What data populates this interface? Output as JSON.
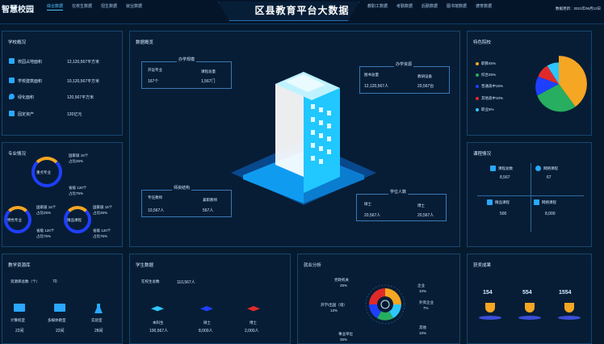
{
  "header": {
    "brand": "智慧校园",
    "nav_left": [
      "综合数据",
      "在校生数据",
      "招生数据",
      "就业数据"
    ],
    "nav_right": [
      "教职工数据",
      "考勤数据",
      "后勤数据",
      "图书馆数据",
      "德育数据"
    ],
    "title": "区县教育平台大数据",
    "time": "数据更新：2021年06月12日"
  },
  "overview": {
    "title": "学校概况",
    "rows": [
      {
        "label": "校园占地面积",
        "value": "12,120,567平方米"
      },
      {
        "label": "学校建筑面积",
        "value": "10,120,567平方米"
      },
      {
        "label": "绿化面积",
        "value": "120,567平方米"
      },
      {
        "label": "固定资产",
        "value": "120亿元"
      }
    ]
  },
  "majors": {
    "title": "专业情况",
    "items": [
      {
        "name": "重点专业",
        "nat": "国家级 15个",
        "nat_pct": "占比25%",
        "prov": "省级 120个",
        "prov_pct": "占比75%"
      },
      {
        "name": "特色专业",
        "nat": "国家级 15个",
        "nat_pct": "占比25%",
        "prov": "省级 120个",
        "prov_pct": "占比75%"
      },
      {
        "name": "精品课程",
        "nat": "国家级 15个",
        "nat_pct": "占比25%",
        "prov": "省级 120个",
        "prov_pct": "占比75%"
      }
    ]
  },
  "center": {
    "title": "数据概览",
    "school": {
      "title": "办学规模",
      "a_label": "开设专业",
      "a_value": "167个",
      "b_label": "课程总量",
      "b_value": "1,567门"
    },
    "resource": {
      "title": "办学资源",
      "a_label": "图书总量",
      "a_value": "12,120,567人",
      "b_label": "教研设备",
      "b_value": "20,567台"
    },
    "staff": {
      "title": "师资结构",
      "a_label": "专任教师",
      "a_value": "10,567人",
      "b_label": "兼职教师",
      "b_value": "567人"
    },
    "degree": {
      "title": "学位人数",
      "a_label": "硕士",
      "a_value": "20,567人",
      "b_label": "博士",
      "b_value": "20,567人"
    }
  },
  "feature": {
    "title": "特色院校",
    "legend": [
      {
        "label": "职教45%",
        "color": "#f5a623"
      },
      {
        "label": "综合25%",
        "color": "#27ae60"
      },
      {
        "label": "普通高中15%",
        "color": "#1f3fff"
      },
      {
        "label": "其他高中10%",
        "color": "#e02a2a"
      },
      {
        "label": "职业5%",
        "color": "#2ec6ff"
      }
    ]
  },
  "courses": {
    "title": "课程情况",
    "items": [
      {
        "label": "课程总数",
        "value": "8,567"
      },
      {
        "label": "网络课程",
        "value": "67"
      },
      {
        "label": "精品课程",
        "value": "500"
      },
      {
        "label": "网络课程",
        "value": "8,000"
      }
    ]
  },
  "teaching": {
    "title": "教学资源库",
    "count_label": "资源库总数（个）",
    "count": "70",
    "items": [
      {
        "label": "计算机室",
        "value": "22间"
      },
      {
        "label": "多媒体教室",
        "value": "22间"
      },
      {
        "label": "实验室",
        "value": "28间"
      }
    ]
  },
  "students": {
    "title": "学生数据",
    "total_label": "在校生总数",
    "total": "110,567人",
    "items": [
      {
        "label": "本科生",
        "value": "100,567人",
        "color": "#2ec6ff"
      },
      {
        "label": "硕士",
        "value": "8,000人",
        "color": "#1f3fff"
      },
      {
        "label": "博士",
        "value": "2,000人",
        "color": "#e02a2a"
      }
    ]
  },
  "employment": {
    "title": "就业分析",
    "items": [
      {
        "label": "党政机关",
        "value": "25%"
      },
      {
        "label": "企业",
        "value": "10%"
      },
      {
        "label": "外资企业",
        "value": "7%"
      },
      {
        "label": "开学/出国（境）",
        "value": "13%"
      },
      {
        "label": "其他",
        "value": "10%"
      },
      {
        "label": "事业单位",
        "value": "35%"
      }
    ]
  },
  "awards": {
    "title": "获奖成果",
    "items": [
      {
        "value": "154"
      },
      {
        "value": "554"
      },
      {
        "value": "1554"
      }
    ]
  }
}
